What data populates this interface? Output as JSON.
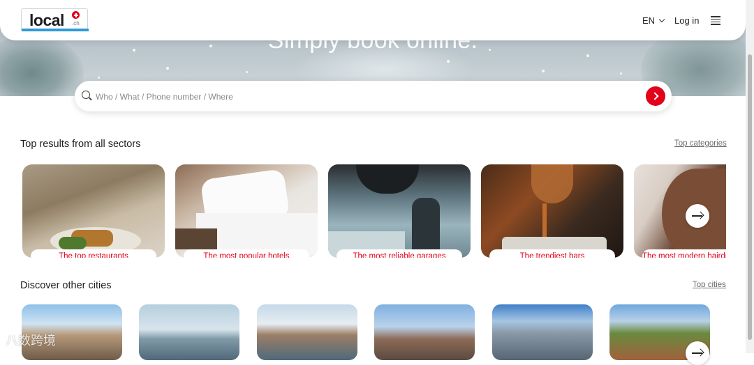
{
  "app": {
    "logo_text": "local",
    "logo_suffix": ".ch"
  },
  "header": {
    "language": "EN",
    "login": "Log in"
  },
  "hero": {
    "title": "Simply book online."
  },
  "search": {
    "placeholder": "Who / What / Phone number / Where"
  },
  "sections": {
    "top_results": {
      "title": "Top results from all sectors",
      "link": "Top categories",
      "cards": [
        {
          "label": "The top restaurants"
        },
        {
          "label": "The most popular hotels"
        },
        {
          "label": "The most reliable garages"
        },
        {
          "label": "The trendiest bars"
        },
        {
          "label": "The most modern hairdressers"
        }
      ]
    },
    "cities": {
      "title": "Discover other cities",
      "link": "Top cities"
    }
  },
  "watermark": "八数跨境",
  "colors": {
    "accent": "#e2001a",
    "logo_bar": "#2f9ad8"
  },
  "icons": [
    "search-icon",
    "chevron-down-icon",
    "menu-icon",
    "arrow-right-icon"
  ]
}
